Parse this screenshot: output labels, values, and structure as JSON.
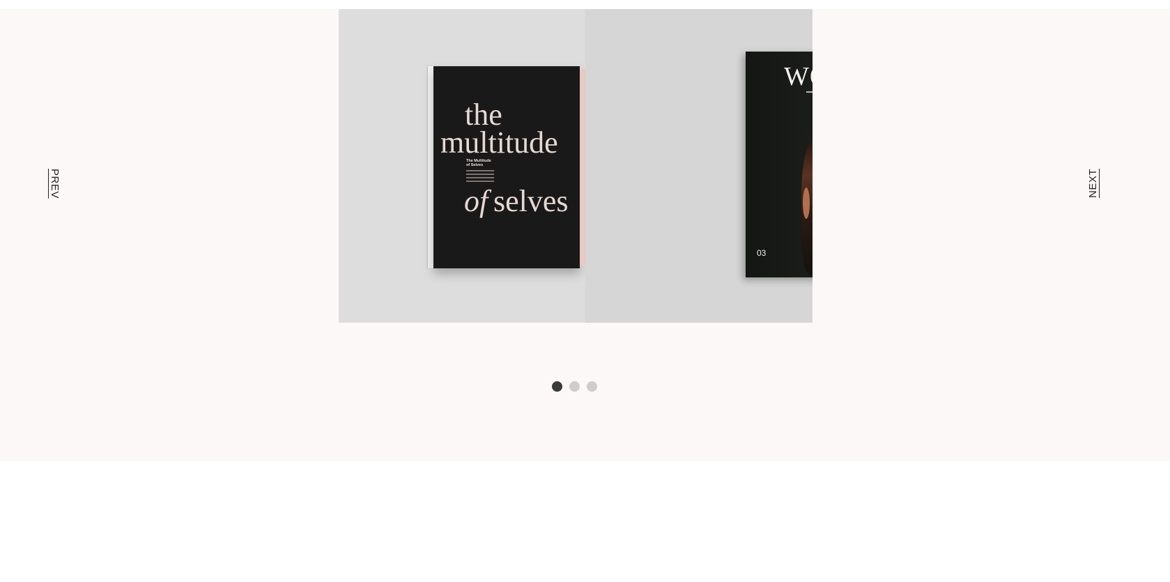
{
  "navigation": {
    "prev_label": "PREV",
    "next_label": "NEXT"
  },
  "slides": [
    {
      "title_line1": "the",
      "title_line2": "multitude",
      "title_of": "of",
      "title_selves": "selves",
      "subtitle_line1": "The Multitude",
      "subtitle_line2": "of Selves"
    },
    {
      "masthead": "WO",
      "issue_number": "03"
    }
  ],
  "pagination": {
    "count": 3,
    "active_index": 0
  },
  "colors": {
    "section_bg": "#fcf8f7",
    "dot_active": "#3a3a3a",
    "dot_inactive": "#cfcccc",
    "book_cover": "#1a1919",
    "title_text": "#e6d8d3"
  }
}
